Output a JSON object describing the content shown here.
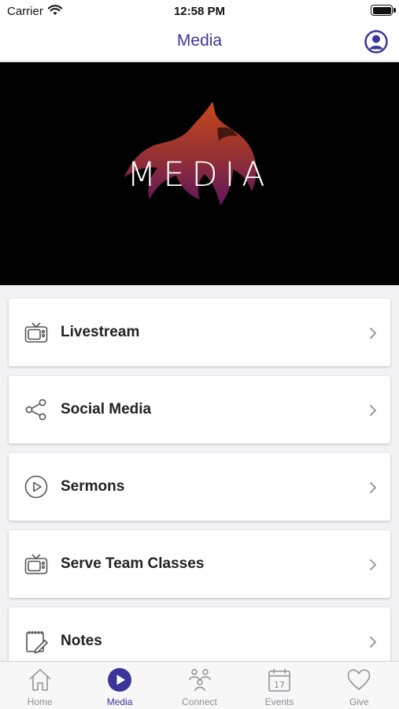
{
  "status_bar": {
    "carrier": "Carrier",
    "time": "12:58 PM"
  },
  "nav": {
    "title": "Media",
    "profile_icon": "user-circle-icon"
  },
  "hero": {
    "text": "MEDIA",
    "background": "#000000",
    "logo_icon": "flame-logo"
  },
  "menu": [
    {
      "label": "Livestream",
      "icon": "tv-icon"
    },
    {
      "label": "Social Media",
      "icon": "share-icon"
    },
    {
      "label": "Sermons",
      "icon": "play-circle-icon"
    },
    {
      "label": "Serve Team Classes",
      "icon": "tv-icon"
    },
    {
      "label": "Notes",
      "icon": "notepad-icon"
    }
  ],
  "tabs": [
    {
      "label": "Home",
      "icon": "home-icon",
      "active": false
    },
    {
      "label": "Media",
      "icon": "play-icon",
      "active": true
    },
    {
      "label": "Connect",
      "icon": "people-icon",
      "active": false
    },
    {
      "label": "Events",
      "icon": "calendar-icon",
      "active": false,
      "calendar_day": "17"
    },
    {
      "label": "Give",
      "icon": "heart-icon",
      "active": false
    }
  ],
  "colors": {
    "accent": "#3a3698",
    "inactive": "#8e8e93",
    "text": "#222222"
  }
}
